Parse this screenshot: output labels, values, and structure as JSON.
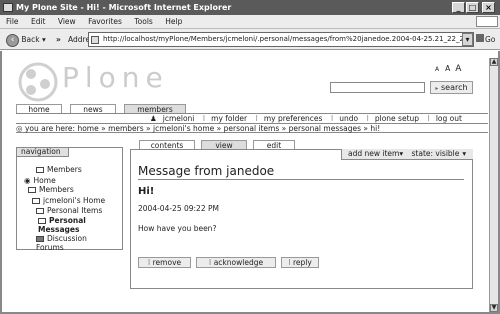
{
  "window": {
    "title": "My Plone Site - Hi! - Microsoft Internet Explorer"
  },
  "menubar": [
    "File",
    "Edit",
    "View",
    "Favorites",
    "Tools",
    "Help"
  ],
  "toolbar": {
    "back": "Back",
    "forward_chevron": "»",
    "address_label": "Address",
    "url": "http://localhost/myPlone/Members/jcmeloni/.personal/messages/from%20janedoe.2004-04-25.21_22_28",
    "go": "Go"
  },
  "site": {
    "logo_text": "Plone",
    "font_sizes": [
      "A",
      "A",
      "A"
    ],
    "search_button": "search"
  },
  "portal_tabs": [
    "home",
    "news",
    "members"
  ],
  "userbar": [
    "jcmeloni",
    "my folder",
    "my preferences",
    "undo",
    "plone setup",
    "log out"
  ],
  "breadcrumb": {
    "prefix": "you are here:",
    "items": [
      "home",
      "members",
      "jcmeloni's home",
      "personal items",
      "personal messages",
      "hi!"
    ]
  },
  "navigation": {
    "title": "navigation",
    "items": [
      "Members",
      "Home",
      "Members",
      "jcmeloni's Home",
      "Personal Items",
      "Personal Messages",
      "Discussion Forums"
    ]
  },
  "content_tabs": [
    "contents",
    "view",
    "edit"
  ],
  "actions": {
    "add_new": "add new item",
    "state": "state: visible"
  },
  "message": {
    "title": "Message from janedoe",
    "subject": "Hi!",
    "date": "2004-04-25 09:22 PM",
    "body": "How have you been?"
  },
  "buttons": [
    "remove",
    "acknowledge",
    "reply"
  ]
}
